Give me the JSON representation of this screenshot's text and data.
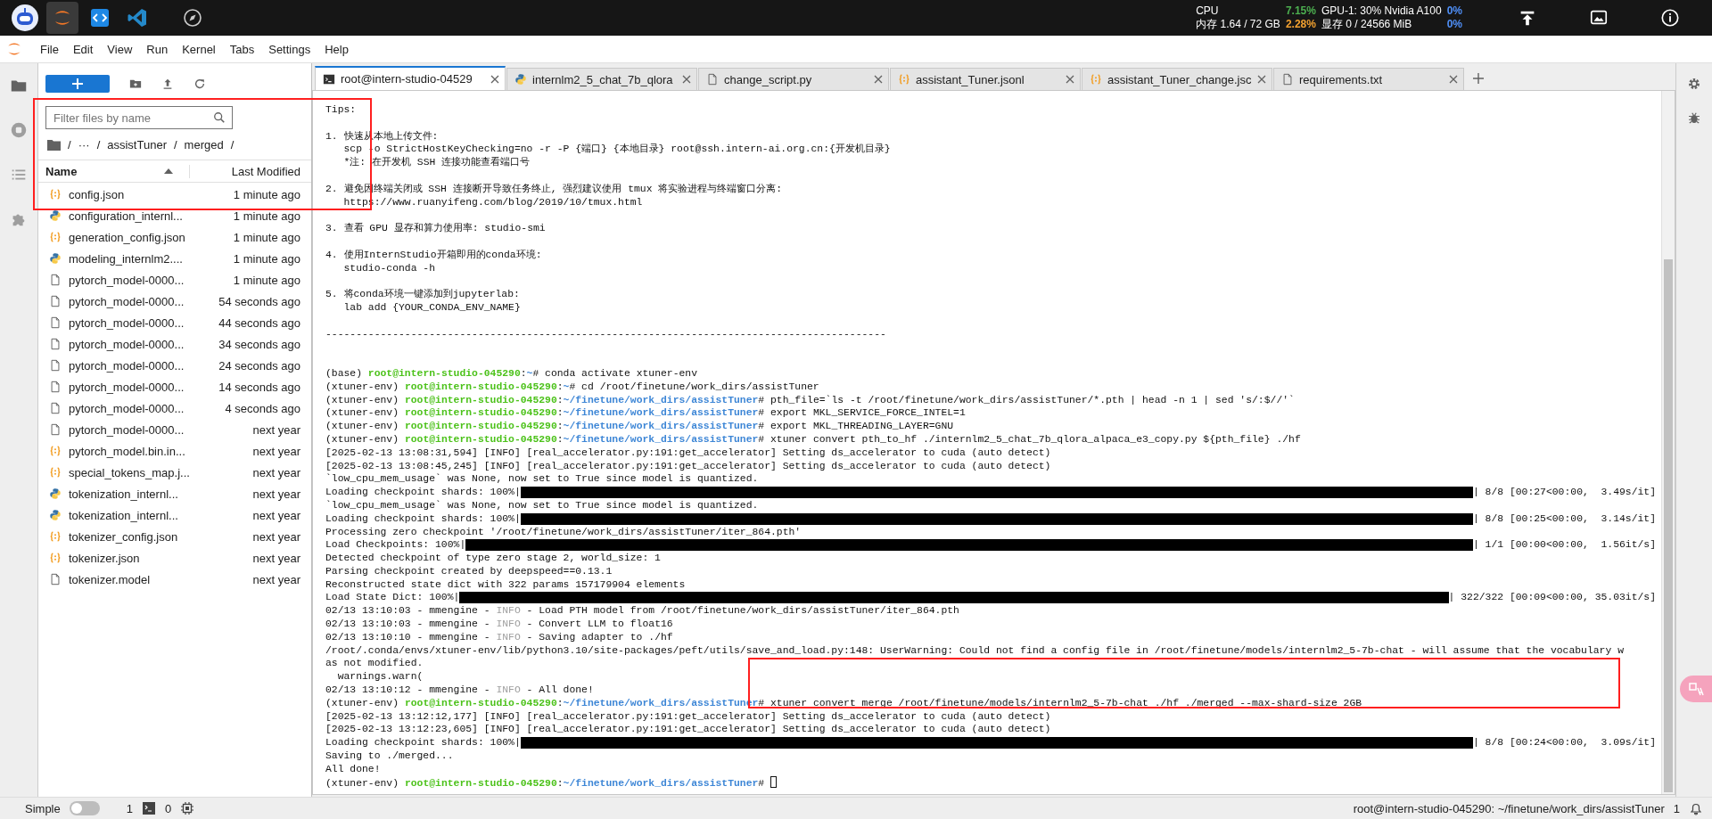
{
  "top_bar": {
    "apps": [
      {
        "kind": "avatar",
        "selected": false
      },
      {
        "kind": "jupyter",
        "selected": true
      },
      {
        "kind": "code",
        "selected": false
      },
      {
        "kind": "vscode",
        "selected": false
      },
      {
        "kind": "compass",
        "selected": false
      }
    ],
    "stats": [
      {
        "label": "CPU",
        "value": "7.15%",
        "color": "#4caf50"
      },
      {
        "label": "GPU-1: 30% Nvidia A100",
        "value": "0%",
        "color": "#4f8ff7"
      },
      {
        "label": "内存 1.64 / 72 GB",
        "value": "2.28%",
        "color": "#f0a030"
      },
      {
        "label": "显存 0 / 24566 MiB",
        "value": "0%",
        "color": "#4f8ff7"
      }
    ]
  },
  "menu": [
    "File",
    "Edit",
    "View",
    "Run",
    "Kernel",
    "Tabs",
    "Settings",
    "Help"
  ],
  "activity_bar": [
    {
      "kind": "folder",
      "selected": true
    },
    {
      "kind": "stop",
      "selected": false
    },
    {
      "kind": "list",
      "selected": false
    },
    {
      "kind": "puzzle",
      "selected": false
    }
  ],
  "file_browser": {
    "filter": {
      "placeholder": "Filter files by name"
    },
    "breadcrumbs": [
      "/",
      "···",
      "/",
      "assistTuner",
      "/",
      "merged",
      "/"
    ],
    "columns": [
      "Name",
      "Last Modified"
    ],
    "files": [
      {
        "kind": "json",
        "name": "config.json",
        "modified": "1 minute ago"
      },
      {
        "kind": "python",
        "name": "configuration_internl...",
        "modified": "1 minute ago"
      },
      {
        "kind": "json",
        "name": "generation_config.json",
        "modified": "1 minute ago"
      },
      {
        "kind": "python",
        "name": "modeling_internlm2....",
        "modified": "1 minute ago"
      },
      {
        "kind": "file",
        "name": "pytorch_model-0000...",
        "modified": "1 minute ago"
      },
      {
        "kind": "file",
        "name": "pytorch_model-0000...",
        "modified": "54 seconds ago"
      },
      {
        "kind": "file",
        "name": "pytorch_model-0000...",
        "modified": "44 seconds ago"
      },
      {
        "kind": "file",
        "name": "pytorch_model-0000...",
        "modified": "34 seconds ago"
      },
      {
        "kind": "file",
        "name": "pytorch_model-0000...",
        "modified": "24 seconds ago"
      },
      {
        "kind": "file",
        "name": "pytorch_model-0000...",
        "modified": "14 seconds ago"
      },
      {
        "kind": "file",
        "name": "pytorch_model-0000...",
        "modified": "4 seconds ago"
      },
      {
        "kind": "file",
        "name": "pytorch_model-0000...",
        "modified": "next year"
      },
      {
        "kind": "json",
        "name": "pytorch_model.bin.in...",
        "modified": "next year"
      },
      {
        "kind": "json",
        "name": "special_tokens_map.j...",
        "modified": "next year"
      },
      {
        "kind": "python",
        "name": "tokenization_internl...",
        "modified": "next year"
      },
      {
        "kind": "python",
        "name": "tokenization_internl...",
        "modified": "next year"
      },
      {
        "kind": "json",
        "name": "tokenizer_config.json",
        "modified": "next year"
      },
      {
        "kind": "json",
        "name": "tokenizer.json",
        "modified": "next year"
      },
      {
        "kind": "file",
        "name": "tokenizer.model",
        "modified": "next year"
      }
    ]
  },
  "tabs": [
    {
      "kind": "terminal",
      "label": "root@intern-studio-04529",
      "selected": true
    },
    {
      "kind": "python",
      "label": "internlm2_5_chat_7b_qlora",
      "selected": false
    },
    {
      "kind": "file",
      "label": "change_script.py",
      "selected": false
    },
    {
      "kind": "json",
      "label": "assistant_Tuner.jsonl",
      "selected": false
    },
    {
      "kind": "json",
      "label": "assistant_Tuner_change.jsc",
      "selected": false
    },
    {
      "kind": "file",
      "label": "requirements.txt",
      "selected": false
    }
  ],
  "terminal": {
    "lines": [
      {
        "kind": "text",
        "text": "Tips:"
      },
      {
        "kind": "blank"
      },
      {
        "kind": "text",
        "text": "1. 快速从本地上传文件:"
      },
      {
        "kind": "text",
        "text": "   scp -o StrictHostKeyChecking=no -r -P {端口} {本地目录} root@ssh.intern-ai.org.cn:{开发机目录}"
      },
      {
        "kind": "text",
        "text": "   *注: 在开发机 SSH 连接功能查看端口号"
      },
      {
        "kind": "blank"
      },
      {
        "kind": "text",
        "text": "2. 避免因终端关闭或 SSH 连接断开导致任务终止, 强烈建议使用 tmux 将实验进程与终端窗口分离:"
      },
      {
        "kind": "text",
        "text": "   https://www.ruanyifeng.com/blog/2019/10/tmux.html"
      },
      {
        "kind": "blank"
      },
      {
        "kind": "text",
        "text": "3. 查看 GPU 显存和算力使用率: studio-smi"
      },
      {
        "kind": "blank"
      },
      {
        "kind": "text",
        "text": "4. 使用InternStudio开箱即用的conda环境:"
      },
      {
        "kind": "text",
        "text": "   studio-conda -h"
      },
      {
        "kind": "blank"
      },
      {
        "kind": "text",
        "text": "5. 将conda环境一键添加到jupyterlab:"
      },
      {
        "kind": "text",
        "text": "   lab add {YOUR_CONDA_ENV_NAME}"
      },
      {
        "kind": "blank"
      },
      {
        "kind": "text",
        "text": "--------------------------------------------------------------------------------------------"
      },
      {
        "kind": "blank"
      },
      {
        "kind": "blank"
      },
      {
        "kind": "rich",
        "segments": [
          {
            "kind": "plain",
            "text": "(base) "
          },
          {
            "kind": "user",
            "text": "root@intern-studio-045290"
          },
          {
            "kind": "plain",
            "text": ":"
          },
          {
            "kind": "path",
            "text": "~"
          },
          {
            "kind": "plain",
            "text": "# conda activate xtuner-env"
          }
        ]
      },
      {
        "kind": "rich",
        "segments": [
          {
            "kind": "plain",
            "text": "(xtuner-env) "
          },
          {
            "kind": "user",
            "text": "root@intern-studio-045290"
          },
          {
            "kind": "plain",
            "text": ":"
          },
          {
            "kind": "path",
            "text": "~"
          },
          {
            "kind": "plain",
            "text": "# cd /root/finetune/work_dirs/assistTuner"
          }
        ]
      },
      {
        "kind": "rich",
        "segments": [
          {
            "kind": "plain",
            "text": "(xtuner-env) "
          },
          {
            "kind": "user",
            "text": "root@intern-studio-045290"
          },
          {
            "kind": "plain",
            "text": ":"
          },
          {
            "kind": "path",
            "text": "~/finetune/work_dirs/assistTuner"
          },
          {
            "kind": "plain",
            "text": "# pth_file=`ls -t /root/finetune/work_dirs/assistTuner/*.pth | head -n 1 | sed 's/:$//'`"
          }
        ]
      },
      {
        "kind": "rich",
        "segments": [
          {
            "kind": "plain",
            "text": "(xtuner-env) "
          },
          {
            "kind": "user",
            "text": "root@intern-studio-045290"
          },
          {
            "kind": "plain",
            "text": ":"
          },
          {
            "kind": "path",
            "text": "~/finetune/work_dirs/assistTuner"
          },
          {
            "kind": "plain",
            "text": "# export MKL_SERVICE_FORCE_INTEL=1"
          }
        ]
      },
      {
        "kind": "rich",
        "segments": [
          {
            "kind": "plain",
            "text": "(xtuner-env) "
          },
          {
            "kind": "user",
            "text": "root@intern-studio-045290"
          },
          {
            "kind": "plain",
            "text": ":"
          },
          {
            "kind": "path",
            "text": "~/finetune/work_dirs/assistTuner"
          },
          {
            "kind": "plain",
            "text": "# export MKL_THREADING_LAYER=GNU"
          }
        ]
      },
      {
        "kind": "rich",
        "segments": [
          {
            "kind": "plain",
            "text": "(xtuner-env) "
          },
          {
            "kind": "user",
            "text": "root@intern-studio-045290"
          },
          {
            "kind": "plain",
            "text": ":"
          },
          {
            "kind": "path",
            "text": "~/finetune/work_dirs/assistTuner"
          },
          {
            "kind": "plain",
            "text": "# xtuner convert pth_to_hf ./internlm2_5_chat_7b_qlora_alpaca_e3_copy.py ${pth_file} ./hf"
          }
        ]
      },
      {
        "kind": "text",
        "text": "[2025-02-13 13:08:31,594] [INFO] [real_accelerator.py:191:get_accelerator] Setting ds_accelerator to cuda (auto detect)"
      },
      {
        "kind": "text",
        "text": "[2025-02-13 13:08:45,245] [INFO] [real_accelerator.py:191:get_accelerator] Setting ds_accelerator to cuda (auto detect)"
      },
      {
        "kind": "text",
        "text": "`low_cpu_mem_usage` was None, now set to True since model is quantized."
      },
      {
        "kind": "progress",
        "label": "Loading checkpoint shards: 100%|",
        "level": 1,
        "suffix": "| 8/8 [00:27<00:00,  3.49s/it]"
      },
      {
        "kind": "text",
        "text": "`low_cpu_mem_usage` was None, now set to True since model is quantized."
      },
      {
        "kind": "progress",
        "label": "Loading checkpoint shards: 100%|",
        "level": 1,
        "suffix": "| 8/8 [00:25<00:00,  3.14s/it]"
      },
      {
        "kind": "text",
        "text": "Processing zero checkpoint '/root/finetune/work_dirs/assistTuner/iter_864.pth'"
      },
      {
        "kind": "progress",
        "label": "Load Checkpoints: 100%|",
        "level": 1,
        "suffix": "| 1/1 [00:00<00:00,  1.56it/s]"
      },
      {
        "kind": "text",
        "text": "Detected checkpoint of type zero stage 2, world_size: 1"
      },
      {
        "kind": "text",
        "text": "Parsing checkpoint created by deepspeed==0.13.1"
      },
      {
        "kind": "text",
        "text": "Reconstructed state dict with 322 params 157179904 elements"
      },
      {
        "kind": "progress",
        "label": "Load State Dict: 100%|",
        "level": 1,
        "suffix": "| 322/322 [00:09<00:00, 35.03it/s]"
      },
      {
        "kind": "rich",
        "segments": [
          {
            "kind": "plain",
            "text": "02/13 13:10:03 - mmengine - "
          },
          {
            "kind": "faint",
            "text": "INFO"
          },
          {
            "kind": "plain",
            "text": " - Load PTH model from /root/finetune/work_dirs/assistTuner/iter_864.pth"
          }
        ]
      },
      {
        "kind": "rich",
        "segments": [
          {
            "kind": "plain",
            "text": "02/13 13:10:03 - mmengine - "
          },
          {
            "kind": "faint",
            "text": "INFO"
          },
          {
            "kind": "plain",
            "text": " - Convert LLM to float16"
          }
        ]
      },
      {
        "kind": "rich",
        "segments": [
          {
            "kind": "plain",
            "text": "02/13 13:10:10 - mmengine - "
          },
          {
            "kind": "faint",
            "text": "INFO"
          },
          {
            "kind": "plain",
            "text": " - Saving adapter to ./hf"
          }
        ]
      },
      {
        "kind": "text",
        "text": "/root/.conda/envs/xtuner-env/lib/python3.10/site-packages/peft/utils/save_and_load.py:148: UserWarning: Could not find a config file in /root/finetune/models/internlm2_5-7b-chat - will assume that the vocabulary w"
      },
      {
        "kind": "text",
        "text": "as not modified."
      },
      {
        "kind": "text",
        "text": "  warnings.warn("
      },
      {
        "kind": "rich",
        "segments": [
          {
            "kind": "plain",
            "text": "02/13 13:10:12 - mmengine - "
          },
          {
            "kind": "faint",
            "text": "INFO"
          },
          {
            "kind": "plain",
            "text": " - All done!"
          }
        ]
      },
      {
        "kind": "rich",
        "segments": [
          {
            "kind": "plain",
            "text": "(xtuner-env) "
          },
          {
            "kind": "user",
            "text": "root@intern-studio-045290"
          },
          {
            "kind": "plain",
            "text": ":"
          },
          {
            "kind": "path",
            "text": "~/finetune/work_dirs/assistTuner"
          },
          {
            "kind": "plain",
            "text": "# xtuner convert merge /root/finetune/models/internlm2_5-7b-chat ./hf ./merged --max-shard-size 2GB"
          }
        ]
      },
      {
        "kind": "text",
        "text": "[2025-02-13 13:12:12,177] [INFO] [real_accelerator.py:191:get_accelerator] Setting ds_accelerator to cuda (auto detect)"
      },
      {
        "kind": "text",
        "text": "[2025-02-13 13:12:23,605] [INFO] [real_accelerator.py:191:get_accelerator] Setting ds_accelerator to cuda (auto detect)"
      },
      {
        "kind": "progress",
        "label": "Loading checkpoint shards: 100%|",
        "level": 1,
        "suffix": "| 8/8 [00:24<00:00,  3.09s/it]"
      },
      {
        "kind": "text",
        "text": "Saving to ./merged..."
      },
      {
        "kind": "text",
        "text": "All done!"
      },
      {
        "kind": "rich",
        "segments": [
          {
            "kind": "plain",
            "text": "(xtuner-env) "
          },
          {
            "kind": "user",
            "text": "root@intern-studio-045290"
          },
          {
            "kind": "plain",
            "text": ":"
          },
          {
            "kind": "path",
            "text": "~/finetune/work_dirs/assistTuner"
          },
          {
            "kind": "plain",
            "text": "# "
          },
          {
            "kind": "cursor"
          }
        ]
      }
    ]
  },
  "status_bar": {
    "mode_label": "Simple",
    "simple_mode": false,
    "terminals": "1",
    "kernels": "0",
    "path": "root@intern-studio-045290: ~/finetune/work_dirs/assistTuner",
    "notifications": "1"
  }
}
